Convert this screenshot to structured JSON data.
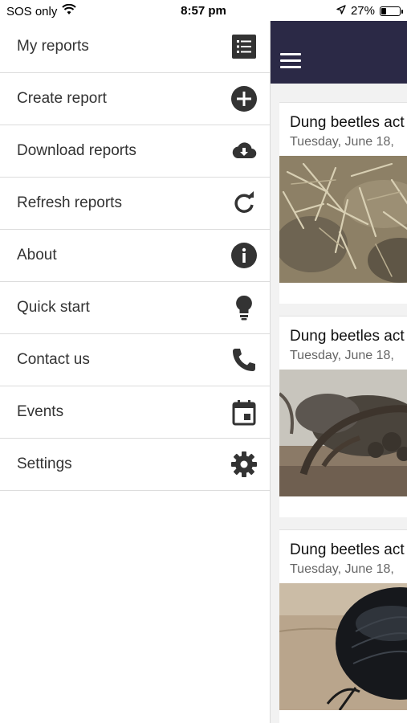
{
  "status_bar": {
    "carrier": "SOS only",
    "time": "8:57 pm",
    "battery_percent": "27%",
    "battery_level": 0.27
  },
  "drawer": {
    "items": [
      {
        "label": "My reports",
        "icon": "list-icon"
      },
      {
        "label": "Create report",
        "icon": "plus-circle-icon"
      },
      {
        "label": "Download reports",
        "icon": "cloud-download-icon"
      },
      {
        "label": "Refresh reports",
        "icon": "refresh-icon"
      },
      {
        "label": "About",
        "icon": "info-icon"
      },
      {
        "label": "Quick start",
        "icon": "lightbulb-icon"
      },
      {
        "label": "Contact us",
        "icon": "phone-icon"
      },
      {
        "label": "Events",
        "icon": "calendar-icon"
      },
      {
        "label": "Settings",
        "icon": "gear-icon"
      }
    ]
  },
  "colors": {
    "app_bar": "#2b2946",
    "icon": "#333333"
  },
  "reports": [
    {
      "title": "Dung beetles act",
      "date": "Tuesday, June 18,",
      "image": "straw-dung-photo"
    },
    {
      "title": "Dung beetles act",
      "date": "Tuesday, June 18,",
      "image": "tree-landscape-photo"
    },
    {
      "title": "Dung beetles act",
      "date": "Tuesday, June 18,",
      "image": "black-beetle-photo"
    }
  ]
}
